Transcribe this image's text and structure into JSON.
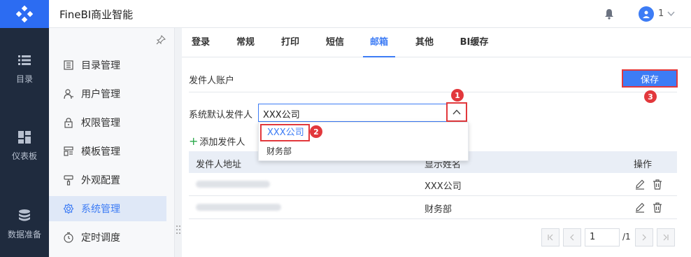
{
  "app": {
    "title": "FineBI商业智能"
  },
  "user": {
    "name": "1"
  },
  "rail": {
    "items": [
      {
        "label": "目录",
        "icon": "list-icon"
      },
      {
        "label": "仪表板",
        "icon": "dashboard-icon"
      },
      {
        "label": "数据准备",
        "icon": "database-icon"
      }
    ]
  },
  "sidemenu": {
    "items": [
      {
        "label": "目录管理",
        "icon": "catalog-icon"
      },
      {
        "label": "用户管理",
        "icon": "user-icon"
      },
      {
        "label": "权限管理",
        "icon": "lock-icon"
      },
      {
        "label": "模板管理",
        "icon": "template-icon"
      },
      {
        "label": "外观配置",
        "icon": "brush-icon"
      },
      {
        "label": "系统管理",
        "icon": "gear-icon",
        "active": true
      },
      {
        "label": "定时调度",
        "icon": "timer-icon"
      }
    ]
  },
  "tabs": [
    "登录",
    "常规",
    "打印",
    "短信",
    "邮箱",
    "其他",
    "BI缓存"
  ],
  "active_tab": "邮箱",
  "content": {
    "section_title": "发件人账户",
    "save_label": "保存",
    "default_sender_label": "系统默认发件人",
    "default_sender_value": "XXX公司",
    "add_sender_label": "添加发件人"
  },
  "dropdown": {
    "options": [
      "XXX公司",
      "财务部"
    ],
    "selected": "XXX公司"
  },
  "table": {
    "columns": [
      "发件人地址",
      "显示姓名",
      "操作"
    ],
    "rows": [
      {
        "display_name": "XXX公司"
      },
      {
        "display_name": "财务部"
      }
    ]
  },
  "pager": {
    "current": "1",
    "total": "/1"
  },
  "badges": [
    "1",
    "2",
    "3"
  ],
  "colors": {
    "accent": "#3d7cf5",
    "rail": "#1f2b3e",
    "highlight": "#e2383c",
    "add": "#2aa84a"
  }
}
